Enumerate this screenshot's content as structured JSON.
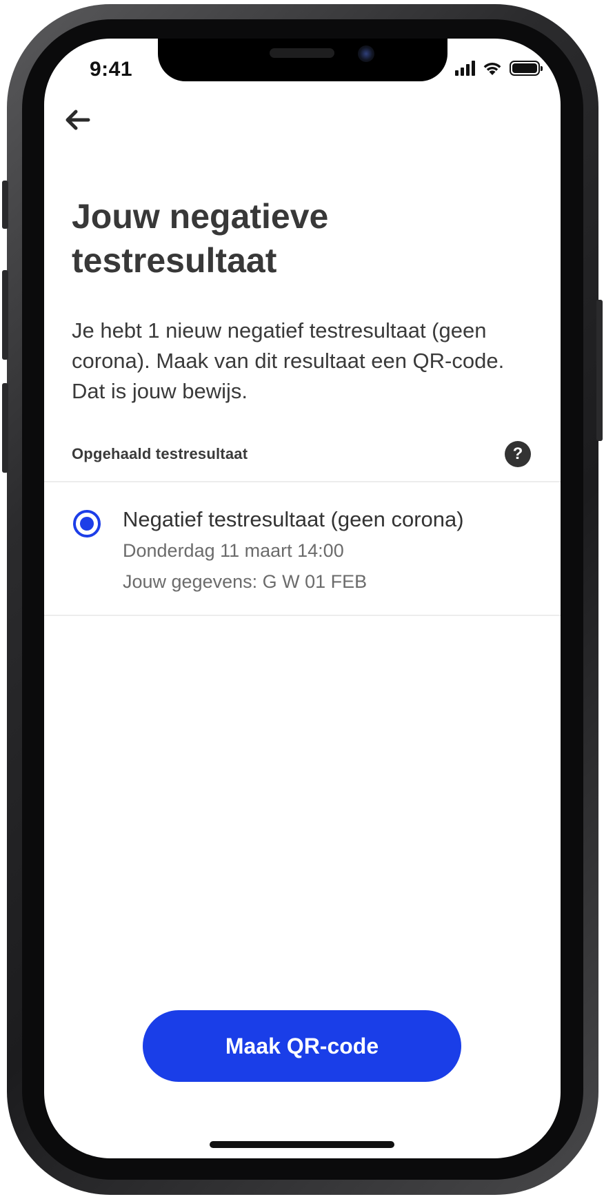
{
  "status_bar": {
    "time": "9:41"
  },
  "header": {
    "back_icon": "arrow-left-icon",
    "title": "Jouw negatieve testresultaat"
  },
  "intro": "Je hebt 1 nieuw negatief testresultaat (geen corona). Maak van dit resultaat een QR-code. Dat is jouw bewijs.",
  "section": {
    "label": "Opgehaald testresultaat",
    "help_icon": "question-mark-icon",
    "help_symbol": "?"
  },
  "result": {
    "selected": true,
    "title": "Negatief testresultaat (geen corona)",
    "date": "Donderdag 11 maart 14:00",
    "details": "Jouw gegevens: G W 01 FEB"
  },
  "primary_button": {
    "label": "Maak QR-code"
  },
  "colors": {
    "accent": "#1a3ee8",
    "title_text": "#383838",
    "secondary_text": "#6b6b6b"
  }
}
